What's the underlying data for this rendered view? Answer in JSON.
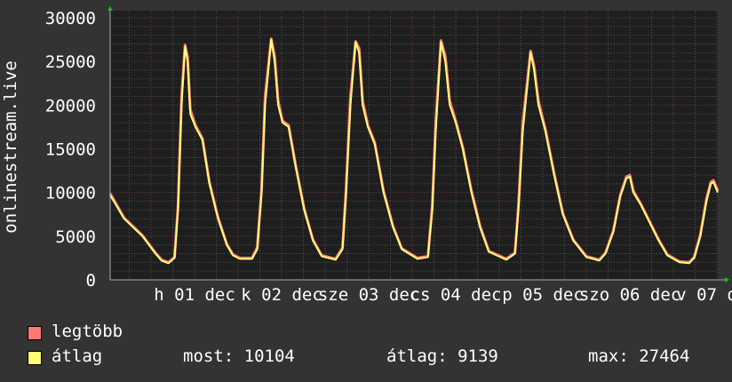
{
  "chart_data": {
    "type": "area",
    "ylabel": "onlinestream.live",
    "ylim": [
      0,
      30000
    ],
    "yticks": [
      "0",
      "5000",
      "10000",
      "15000",
      "20000",
      "25000",
      "30000"
    ],
    "xlim": [
      0.53,
      7.51
    ],
    "xunit": "day of December",
    "xtick_labels": [
      {
        "day": 1,
        "label": "h 01 dec"
      },
      {
        "day": 2,
        "label": "k 02 dec"
      },
      {
        "day": 3,
        "label": "sze 03 dec"
      },
      {
        "day": 4,
        "label": "cs 04 dec"
      },
      {
        "day": 5,
        "label": "p 05 dec"
      },
      {
        "day": 6,
        "label": "szo 06 dec"
      },
      {
        "day": 7,
        "label": "v 07 dec"
      }
    ],
    "grid": true,
    "x": [
      0.53,
      0.69,
      0.9,
      1.05,
      1.12,
      1.2,
      1.27,
      1.31,
      1.35,
      1.39,
      1.42,
      1.45,
      1.51,
      1.59,
      1.67,
      1.77,
      1.87,
      1.94,
      2.02,
      2.16,
      2.22,
      2.27,
      2.31,
      2.38,
      2.42,
      2.46,
      2.51,
      2.58,
      2.66,
      2.76,
      2.86,
      2.96,
      3.12,
      3.2,
      3.24,
      3.29,
      3.35,
      3.39,
      3.43,
      3.49,
      3.57,
      3.67,
      3.78,
      3.88,
      4.06,
      4.18,
      4.23,
      4.27,
      4.33,
      4.38,
      4.43,
      4.5,
      4.58,
      4.68,
      4.78,
      4.88,
      5.08,
      5.18,
      5.22,
      5.27,
      5.36,
      5.4,
      5.45,
      5.53,
      5.63,
      5.73,
      5.85,
      6.0,
      6.15,
      6.22,
      6.31,
      6.39,
      6.46,
      6.5,
      6.54,
      6.63,
      6.73,
      6.83,
      6.93,
      7.07,
      7.18,
      7.24,
      7.31,
      7.38,
      7.43,
      7.46,
      7.51
    ],
    "series": [
      {
        "name": "legtöbb",
        "color": "#ff7777",
        "values": [
          9900,
          7100,
          5100,
          3100,
          2300,
          2000,
          2600,
          8500,
          21000,
          26900,
          25500,
          19500,
          17700,
          16200,
          11200,
          7100,
          4100,
          2900,
          2500,
          2500,
          3700,
          10500,
          21000,
          27600,
          25600,
          20500,
          18200,
          17700,
          13200,
          8100,
          4600,
          2800,
          2400,
          3700,
          10500,
          21000,
          27300,
          26500,
          20500,
          17700,
          15700,
          10200,
          6100,
          3600,
          2500,
          2700,
          8500,
          18000,
          27400,
          25600,
          20500,
          18200,
          15200,
          10200,
          6100,
          3300,
          2400,
          3100,
          8500,
          18000,
          26200,
          24500,
          20500,
          17200,
          12200,
          7600,
          4600,
          2700,
          2300,
          3100,
          5600,
          9700,
          11800,
          12000,
          10200,
          8600,
          6600,
          4600,
          2900,
          2100,
          2000,
          2600,
          5200,
          9300,
          11200,
          11400,
          10200
        ]
      },
      {
        "name": "átlag",
        "color": "#ffff77",
        "values": [
          9700,
          7000,
          5000,
          3000,
          2200,
          1900,
          2500,
          8000,
          20000,
          26700,
          25000,
          19000,
          17500,
          16000,
          11000,
          7000,
          4000,
          2800,
          2400,
          2400,
          3500,
          10000,
          20000,
          27500,
          25000,
          20000,
          18000,
          17500,
          13000,
          8000,
          4500,
          2700,
          2300,
          3500,
          10000,
          20000,
          27200,
          26000,
          20000,
          17500,
          15500,
          10000,
          6000,
          3500,
          2400,
          2600,
          8000,
          17000,
          27200,
          25000,
          20000,
          18000,
          15000,
          10000,
          6000,
          3200,
          2300,
          3000,
          8000,
          17000,
          26000,
          24000,
          20000,
          17000,
          12000,
          7500,
          4500,
          2600,
          2200,
          3000,
          5500,
          9500,
          11600,
          11800,
          10000,
          8500,
          6500,
          4500,
          2800,
          2000,
          1900,
          2500,
          5000,
          9000,
          11000,
          11200,
          10000
        ]
      }
    ]
  },
  "legend": {
    "max_label": "legtöbb",
    "avg_label": "átlag",
    "now": "most: 10104",
    "average": "átlag: 9139",
    "maximum": "max: 27464"
  }
}
